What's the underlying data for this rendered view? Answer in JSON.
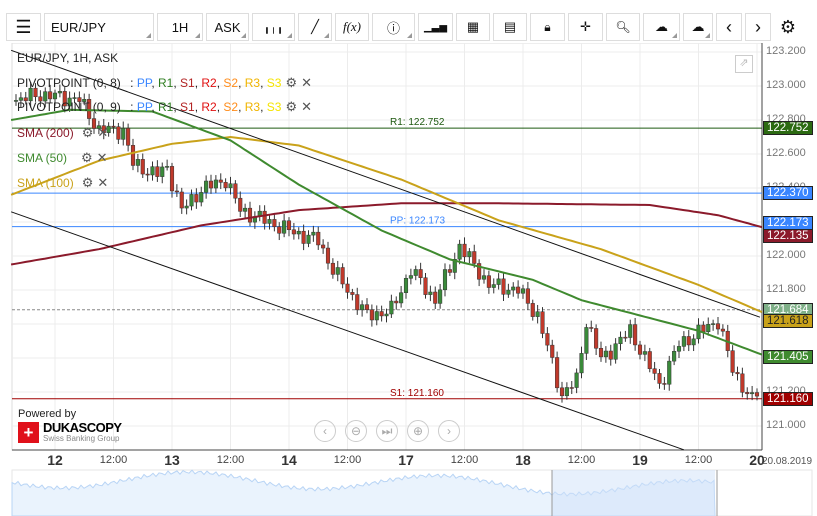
{
  "toolbar": {
    "instrument": "EUR/JPY",
    "period": "1H",
    "side": "ASK",
    "buttons": [
      "menu-icon",
      "candle-type-icon",
      "draw-icon",
      "indicator-fx-icon",
      "info-icon",
      "volume-icon",
      "calendar-icon",
      "news-icon",
      "lock-icon",
      "crosshair-icon",
      "zoom-chart-icon",
      "upload-icon",
      "download-icon",
      "prev-icon",
      "next-icon",
      "settings-icon"
    ],
    "fx": "f(x)"
  },
  "legend": {
    "title": "EUR/JPY, 1H, ASK",
    "pivots": [
      {
        "name": "PIVOTPOINT (0, 8)"
      },
      {
        "name": "PIVOTPOINT (0, 9)"
      }
    ],
    "pivot_parts": [
      {
        "t": "PP",
        "c": "#3a86ff"
      },
      {
        "t": "R1",
        "c": "#2e7d20"
      },
      {
        "t": "S1",
        "c": "#b22222"
      },
      {
        "t": "R2",
        "c": "#e01010"
      },
      {
        "t": "S2",
        "c": "#ff8c1a"
      },
      {
        "t": "R3",
        "c": "#f0b400"
      },
      {
        "t": "S3",
        "c": "#f5e400"
      }
    ],
    "sma": [
      {
        "name": "SMA (200)",
        "color": "#8b1a2b"
      },
      {
        "name": "SMA (50)",
        "color": "#3f8a2f"
      },
      {
        "name": "SMA (100)",
        "color": "#c9a21a"
      }
    ]
  },
  "levels": [
    {
      "label": "R1: 122.752",
      "price": 122.752,
      "color": "#1e5a10"
    },
    {
      "label": "",
      "price": 122.37,
      "color": "#3a86ff"
    },
    {
      "label": "PP: 122.173",
      "price": 122.173,
      "color": "#3a86ff"
    },
    {
      "label": "S1: 121.160",
      "price": 121.16,
      "color": "#a00000"
    }
  ],
  "tags": [
    {
      "text": "122.752",
      "price": 122.752,
      "bg": "#2c6a12"
    },
    {
      "text": "122.370",
      "price": 122.37,
      "bg": "#3a86ff"
    },
    {
      "text": "122.173",
      "price": 122.173,
      "bg": "#3a86ff"
    },
    {
      "text": "122.135",
      "price": 122.135,
      "bg": "#8b1a2b"
    },
    {
      "text": "121.684",
      "price": 121.684,
      "bg": "#7fb088"
    },
    {
      "text": "121.618",
      "price": 121.618,
      "bg": "#c9a21a",
      "fg": "#222"
    },
    {
      "text": "121.405",
      "price": 121.405,
      "bg": "#3f8a2f"
    },
    {
      "text": "121.160",
      "price": 121.16,
      "bg": "#a00000"
    }
  ],
  "yticks": [
    "123.200",
    "123.000",
    "122.800",
    "122.600",
    "122.400",
    "122.200",
    "122.000",
    "121.800",
    "121.600",
    "121.400",
    "121.200",
    "121.000"
  ],
  "xticks": [
    {
      "t": "12",
      "h": 0,
      "day": true
    },
    {
      "t": "12:00",
      "h": 12
    },
    {
      "t": "13",
      "h": 24,
      "day": true
    },
    {
      "t": "12:00",
      "h": 36
    },
    {
      "t": "14",
      "h": 48,
      "day": true
    },
    {
      "t": "12:00",
      "h": 60
    },
    {
      "t": "17",
      "h": 72,
      "day": true
    },
    {
      "t": "12:00",
      "h": 84
    },
    {
      "t": "18",
      "h": 96,
      "day": true
    },
    {
      "t": "12:00",
      "h": 108
    },
    {
      "t": "19",
      "h": 120,
      "day": true
    },
    {
      "t": "12:00",
      "h": 132
    },
    {
      "t": "20",
      "h": 144,
      "day": true
    }
  ],
  "date_label": "20.08.2019",
  "brand": {
    "powered": "Powered by",
    "name": "DUKASCOPY",
    "sub": "Swiss Banking Group"
  },
  "nav_buttons": [
    "‹",
    "⊖",
    "⏭",
    "⊕",
    "›"
  ],
  "chart_data": {
    "type": "candlestick",
    "ylim": [
      120.94,
      123.26
    ],
    "price_path": [
      [
        -8,
        122.92
      ],
      [
        -3,
        122.95
      ],
      [
        5,
        122.92
      ],
      [
        9,
        122.74
      ],
      [
        14,
        122.74
      ],
      [
        16,
        122.54
      ],
      [
        21,
        122.48
      ],
      [
        23,
        122.52
      ],
      [
        26,
        122.27
      ],
      [
        30,
        122.39
      ],
      [
        35,
        122.45
      ],
      [
        38,
        122.27
      ],
      [
        43,
        122.21
      ],
      [
        48,
        122.15
      ],
      [
        54,
        122.09
      ],
      [
        57,
        121.92
      ],
      [
        60,
        121.8
      ],
      [
        64,
        121.65
      ],
      [
        69,
        121.68
      ],
      [
        73,
        121.92
      ],
      [
        78,
        121.74
      ],
      [
        83,
        122.06
      ],
      [
        89,
        121.83
      ],
      [
        95,
        121.8
      ],
      [
        99,
        121.65
      ],
      [
        104,
        121.18
      ],
      [
        107,
        121.27
      ],
      [
        109,
        121.62
      ],
      [
        112,
        121.39
      ],
      [
        118,
        121.56
      ],
      [
        124,
        121.24
      ],
      [
        128,
        121.48
      ],
      [
        136,
        121.62
      ],
      [
        139,
        121.33
      ],
      [
        143,
        121.15
      ],
      [
        145,
        121.24
      ]
    ],
    "sma50": [
      [
        -9,
        122.8
      ],
      [
        3,
        122.86
      ],
      [
        20,
        122.85
      ],
      [
        36,
        122.68
      ],
      [
        50,
        122.42
      ],
      [
        67,
        122.15
      ],
      [
        81,
        121.98
      ],
      [
        98,
        121.86
      ],
      [
        108,
        121.74
      ],
      [
        120,
        121.65
      ],
      [
        132,
        121.56
      ],
      [
        145,
        121.42
      ]
    ],
    "sma100": [
      [
        -9,
        122.36
      ],
      [
        9,
        122.56
      ],
      [
        24,
        122.66
      ],
      [
        36,
        122.7
      ],
      [
        50,
        122.65
      ],
      [
        71,
        122.45
      ],
      [
        91,
        122.21
      ],
      [
        112,
        122.04
      ],
      [
        132,
        121.83
      ],
      [
        145,
        121.67
      ]
    ],
    "sma200": [
      [
        -9,
        121.95
      ],
      [
        9,
        122.04
      ],
      [
        30,
        122.18
      ],
      [
        50,
        122.27
      ],
      [
        71,
        122.31
      ],
      [
        91,
        122.31
      ],
      [
        122,
        122.3
      ],
      [
        136,
        122.24
      ],
      [
        145,
        122.17
      ]
    ],
    "trendlines": [
      [
        [
          -9,
          123.21
        ],
        [
          144.6,
          121.64
        ]
      ],
      [
        [
          -9,
          122.26
        ],
        [
          129,
          120.86
        ]
      ]
    ],
    "last_price": 121.684
  }
}
